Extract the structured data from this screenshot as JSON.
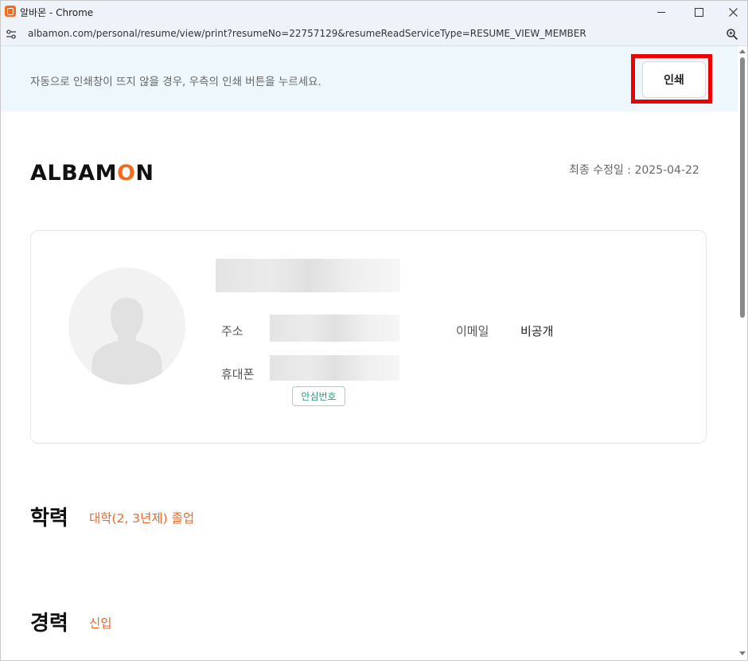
{
  "window": {
    "title": "알바몬 - Chrome",
    "url": "albamon.com/personal/resume/view/print?resumeNo=22757129&resumeReadServiceType=RESUME_VIEW_MEMBER"
  },
  "notice": {
    "text": "자동으로 인쇄창이 뜨지 않을 경우, 우측의 인쇄 버튼을 누르세요.",
    "print_label": "인쇄"
  },
  "header": {
    "logo_pre": "ALBAM",
    "logo_o": "O",
    "logo_post": "N",
    "modified": "최종 수정일 : 2025-04-22"
  },
  "profile": {
    "address_label": "주소",
    "phone_label": "휴대폰",
    "safe_number_badge": "안심번호",
    "email_label": "이메일",
    "email_value": "비공개"
  },
  "sections": {
    "education_title": "학력",
    "education_value": "대학(2, 3년제) 졸업",
    "career_title": "경력",
    "career_value": "신입"
  },
  "colors": {
    "accent": "#f46c1b",
    "highlight": "#ee0000",
    "badge": "#2a9c86"
  }
}
